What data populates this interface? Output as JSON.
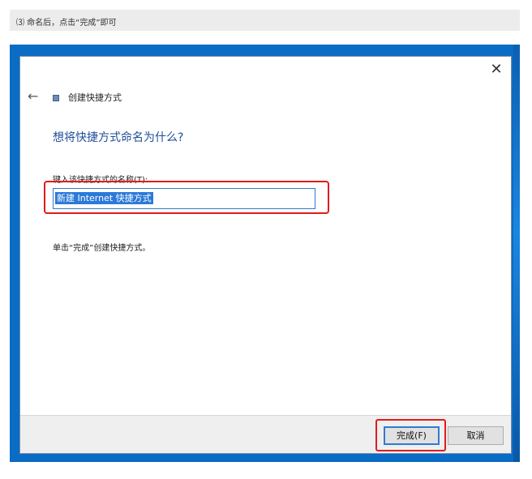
{
  "caption": "⑶ 命名后，点击“完成”即可",
  "dialog": {
    "title": "创建快捷方式",
    "heading": "想将快捷方式命名为什么?",
    "name_label": "键入该快捷方式的名称(T):",
    "name_value": "新建 Internet 快捷方式",
    "finish_instruction": "单击“完成”创建快捷方式。",
    "finish_button": "完成(F)",
    "cancel_button": "取消",
    "close_symbol": "✕",
    "back_symbol": "←"
  },
  "colors": {
    "highlight": "#e01c1c",
    "heading": "#1f4e99",
    "selection": "#2b79d8",
    "desktop": "#0a6cc4"
  },
  "icons": [
    "close-icon",
    "back-arrow-icon",
    "wizard-icon"
  ]
}
